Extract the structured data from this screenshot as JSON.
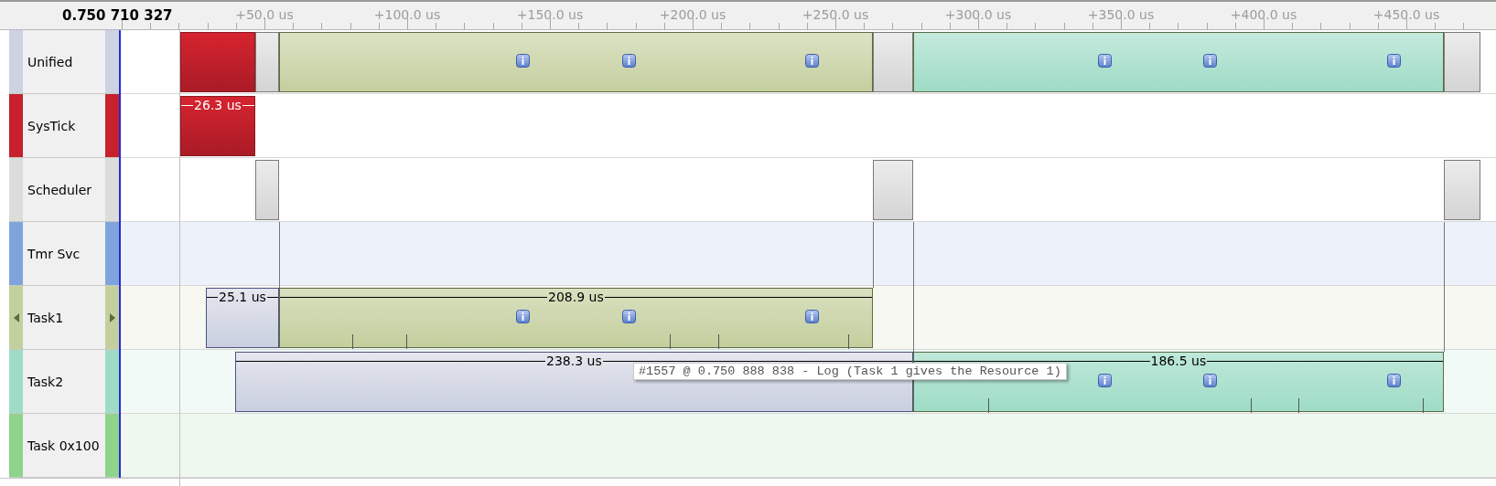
{
  "header": {
    "timestamp": "0.750 710 327",
    "ticks": [
      "+50.0 us",
      "+100.0 us",
      "+150.0 us",
      "+200.0 us",
      "+250.0 us",
      "+300.0 us",
      "+350.0 us",
      "+400.0 us",
      "+450.0 us"
    ]
  },
  "rows": [
    {
      "name": "Unified",
      "color": "#ccd3e2",
      "selected": false,
      "segments": [
        {
          "kind": "interrupt"
        },
        {
          "kind": "scheduler"
        },
        {
          "kind": "running",
          "color": "#c4cf9e"
        },
        {
          "kind": "scheduler"
        },
        {
          "kind": "running",
          "color": "#9edcc6"
        },
        {
          "kind": "scheduler"
        }
      ]
    },
    {
      "name": "SysTick",
      "color": "#c8202c",
      "selected": false,
      "segments": [
        {
          "kind": "interrupt",
          "label": "26.3 us"
        }
      ]
    },
    {
      "name": "Scheduler",
      "color": "#dcdcdc",
      "selected": false,
      "segments": [
        {
          "kind": "scheduler"
        },
        {
          "kind": "scheduler"
        },
        {
          "kind": "scheduler"
        }
      ]
    },
    {
      "name": "Tmr Svc",
      "color": "#7fa4dc",
      "selected": false,
      "segments": []
    },
    {
      "name": "Task1",
      "color": "#c4cf9e",
      "selected": true,
      "segments": [
        {
          "kind": "waiting",
          "label": "25.1 us"
        },
        {
          "kind": "running",
          "color": "#c4cf9e",
          "label": "208.9 us"
        }
      ]
    },
    {
      "name": "Task2",
      "color": "#9edcc6",
      "selected": false,
      "segments": [
        {
          "kind": "waiting",
          "label": "238.3 us"
        },
        {
          "kind": "running",
          "color": "#9edcc6",
          "label": "186.5 us"
        }
      ]
    },
    {
      "name": "Task 0x100",
      "color": "#8ed48a",
      "selected": false,
      "segments": []
    }
  ],
  "tooltip": {
    "text": "#1557 @ 0.750 888 838 - Log (Task 1 gives the Resource 1)"
  }
}
